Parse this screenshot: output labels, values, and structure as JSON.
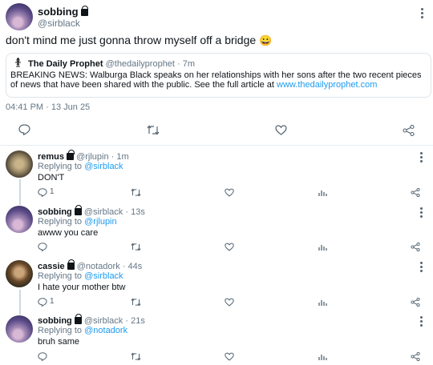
{
  "main_tweet": {
    "display_name": "sobbing",
    "handle": "@sirblack",
    "text": "don't mind me just gonna throw myself off a bridge",
    "emoji": "😀",
    "timestamp": "04:41 PM · 13 Jun 25",
    "quote": {
      "display_name": "The Daily Prophet",
      "handle": "@thedailyprophet",
      "age": "· 7m",
      "text": "BREAKING NEWS: Walburga Black speaks on her relationships with her sons after the two recent pieces of news that have been shared with the public. See the full article at",
      "link": "www.thedailyprophet.com"
    }
  },
  "replies": [
    {
      "display_name": "remus",
      "handle": "@rjlupin",
      "age": "· 1m",
      "replying_label": "Replying to",
      "replying_to": "@sirblack",
      "text": "DON'T",
      "reply_count": "1"
    },
    {
      "display_name": "sobbing",
      "handle": "@sirblack",
      "age": "· 13s",
      "replying_label": "Replying to",
      "replying_to": "@rjlupin",
      "text": "awww you care",
      "reply_count": ""
    },
    {
      "display_name": "cassie",
      "handle": "@notadork",
      "age": "· 44s",
      "replying_label": "Replying to",
      "replying_to": "@sirblack",
      "text": "I hate your mother btw",
      "reply_count": "1"
    },
    {
      "display_name": "sobbing",
      "handle": "@sirblack",
      "age": "· 21s",
      "replying_label": "Replying to",
      "replying_to": "@notadork",
      "text": "bruh same",
      "reply_count": ""
    }
  ],
  "colors": {
    "link": "#1d9bf0",
    "muted": "#657786",
    "divider": "#e6ecf0"
  },
  "icons": [
    "reply-icon",
    "retweet-icon",
    "like-icon",
    "share-icon",
    "analytics-icon",
    "more-icon",
    "lock-icon"
  ]
}
